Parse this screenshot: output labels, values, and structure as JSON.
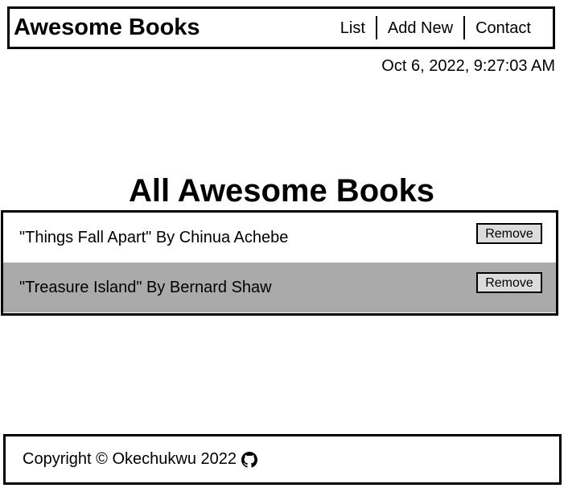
{
  "header": {
    "brand": "Awesome Books",
    "nav": [
      {
        "label": "List"
      },
      {
        "label": "Add New"
      },
      {
        "label": "Contact"
      }
    ]
  },
  "datetime": "Oct 6, 2022, 9:27:03 AM",
  "main": {
    "title": "All Awesome Books",
    "books": [
      {
        "text": "\"Things Fall Apart\" By Chinua Achebe",
        "remove_label": "Remove"
      },
      {
        "text": "\"Treasure Island\" By Bernard Shaw",
        "remove_label": "Remove"
      }
    ]
  },
  "footer": {
    "copyright": "Copyright © Okechukwu 2022",
    "icon": "github-icon"
  },
  "colors": {
    "border": "#000000",
    "alt_row": "#aaaaaa",
    "button_bg": "#dcdcdc"
  }
}
